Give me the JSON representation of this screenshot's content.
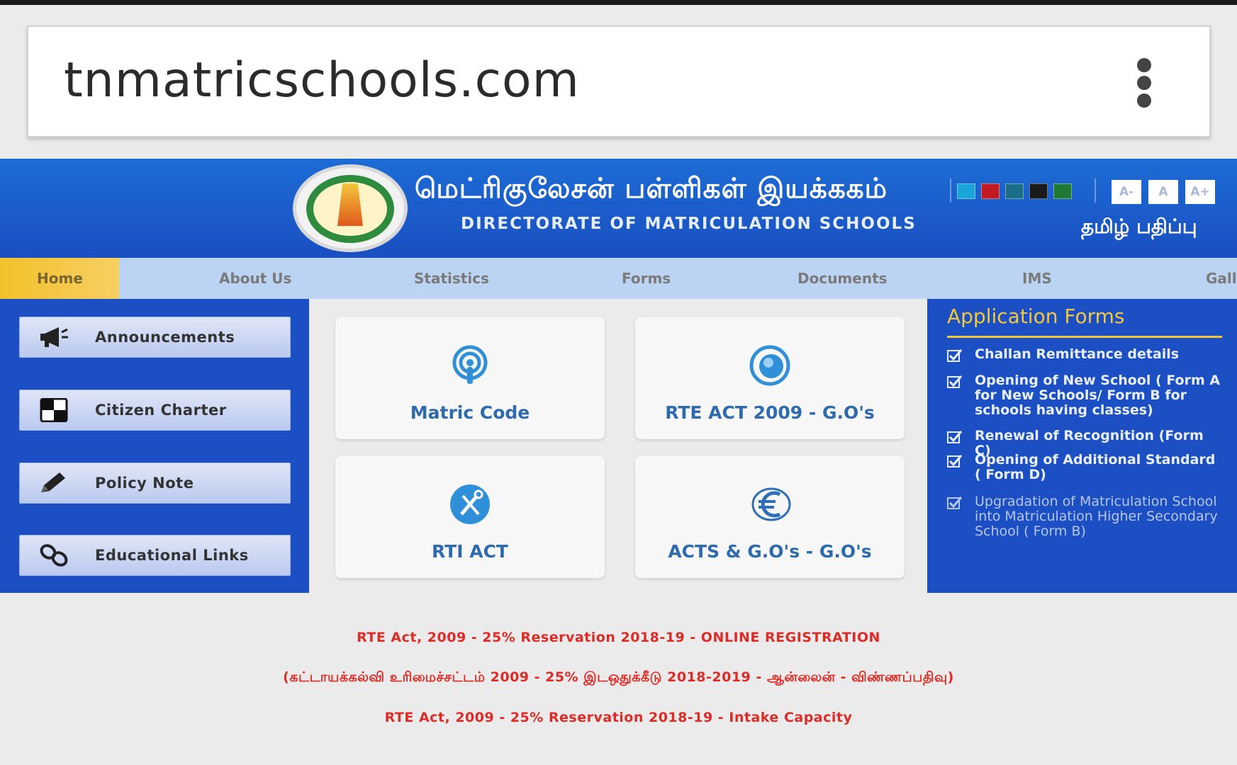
{
  "browser": {
    "url": "tnmatricschools.com"
  },
  "header": {
    "title_tamil": "மெட்ரிகுலேசன் பள்ளிகள் இயக்ககம்",
    "title_english": "DIRECTORATE OF MATRICULATION SCHOOLS",
    "tamil_edition_link": "தமிழ் பதிப்பு",
    "font_buttons": [
      "A-",
      "A",
      "A+"
    ],
    "theme_colors": [
      "#19a5d7",
      "#c11a22",
      "#1a6f86",
      "#1a1a1a",
      "#1e7a34"
    ]
  },
  "nav": [
    "Home",
    "About Us",
    "Statistics",
    "Forms",
    "Documents",
    "IMS",
    "Gall"
  ],
  "sidebar": [
    "Announcements",
    "Citizen Charter",
    "Policy Note",
    "Educational Links"
  ],
  "tiles": [
    "Matric Code",
    "RTE ACT 2009 - G.O's",
    "RTI ACT",
    "ACTS & G.O's - G.O's"
  ],
  "application_forms": {
    "title": "Application Forms",
    "items": [
      "Challan Remittance details",
      "Opening of New School ( Form A for New Schools/ Form B for schools having classes)",
      "Renewal of Recognition (Form C)",
      "Opening of Additional Standard ( Form D)",
      "Upgradation of Matriculation School into Matriculation Higher Secondary School ( Form B)"
    ]
  },
  "notices": [
    "RTE Act, 2009 - 25% Reservation 2018-19 - ONLINE REGISTRATION",
    "(கட்டாயக்கல்வி உரிமைச்சட்டம் 2009 - 25% இடஒதுக்கீடு 2018-2019 - ஆன்லைன் - விண்ணப்பதிவு)",
    "RTE Act, 2009 - 25% Reservation 2018-19 - Intake Capacity"
  ],
  "colors": {
    "header_blue": "#1a4fc0",
    "nav_active": "#f3c12c",
    "accent_yellow": "#f3c83a",
    "notice_red": "#e02a25",
    "tile_text": "#2e6aae"
  }
}
